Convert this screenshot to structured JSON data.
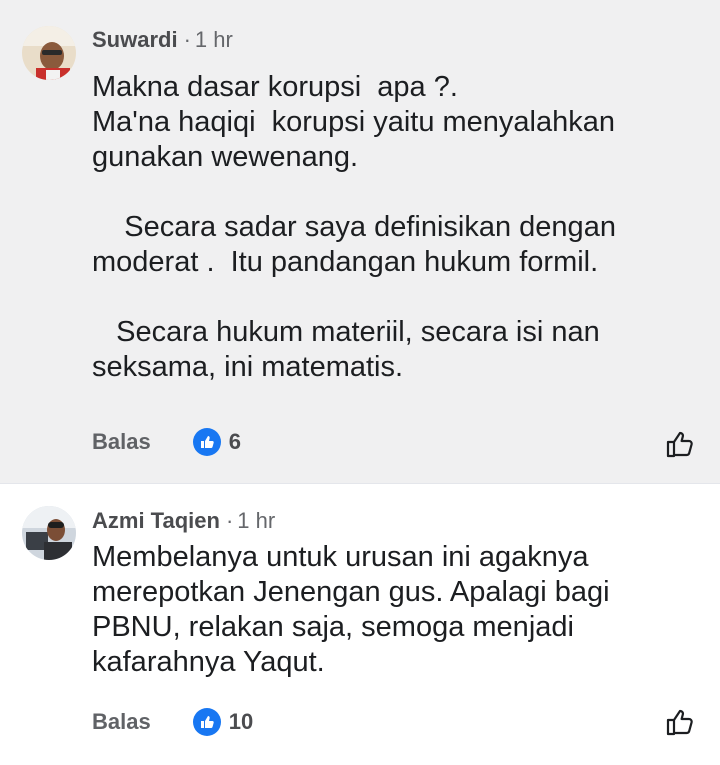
{
  "comments": [
    {
      "author": "Suwardi",
      "time": "1 hr",
      "separator": "·",
      "lines": [
        "Makna dasar korupsi  apa ?.",
        "Ma'na haqiqi  korupsi yaitu menyalahkan",
        "gunakan wewenang.",
        "",
        "    Secara sadar saya definisikan dengan",
        "moderat .  Itu pandangan hukum formil.",
        "",
        "   Secara hukum materiil, secara isi nan",
        "seksama, ini matematis."
      ],
      "reply_label": "Balas",
      "reaction_count": "6",
      "reaction_icon": "like-icon"
    },
    {
      "author": "Azmi Taqien",
      "time": "1 hr",
      "separator": "·",
      "lines": [
        "Membelanya untuk urusan ini agaknya",
        "merepotkan Jenengan gus. Apalagi bagi",
        "PBNU, relakan saja, semoga menjadi",
        "kafarahnya Yaqut."
      ],
      "reply_label": "Balas",
      "reaction_count": "10",
      "reaction_icon": "like-icon"
    }
  ],
  "colors": {
    "highlight_bg": "#f0f0f1",
    "like_blue": "#1877f2",
    "meta_grey": "#65676b"
  }
}
